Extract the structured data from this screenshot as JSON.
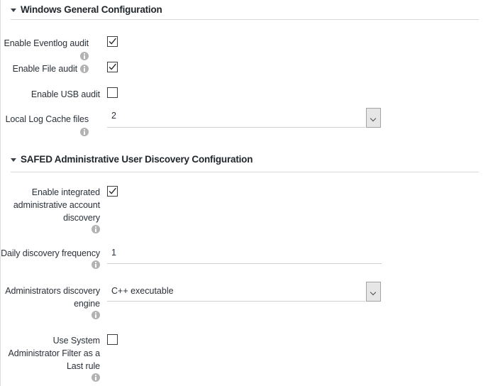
{
  "sections": [
    {
      "id": "windows-general",
      "title": "Windows General Configuration",
      "caret": "caret-down-icon",
      "fields": [
        {
          "id": "enable-eventlog-audit",
          "label": "Enable Eventlog audit",
          "info_icon": "info-icon",
          "control": "checkbox",
          "checked": true,
          "checked_label": "Checked"
        },
        {
          "id": "enable-file-audit",
          "label": "Enable File audit",
          "info_icon": "info-icon",
          "control": "checkbox",
          "checked": true,
          "checked_label": "Checked"
        },
        {
          "id": "enable-usb-audit",
          "label": "Enable USB audit",
          "info_icon": null,
          "control": "checkbox",
          "checked": false,
          "checked_label": "Unchecked"
        },
        {
          "id": "local-log-cache-files",
          "label": "Local Log Cache files",
          "info_icon": "info-icon",
          "control": "select",
          "value": "2",
          "chevron_icon": "chevron-down-icon"
        }
      ]
    },
    {
      "id": "safed-admin-discovery",
      "title": "SAFED Administrative User Discovery Configuration",
      "caret": "caret-down-icon",
      "fields": [
        {
          "id": "enable-integrated-admin-account-discovery",
          "label_lines": [
            "Enable integrated",
            "administrative account",
            "discovery"
          ],
          "info_icon": "info-icon",
          "control": "checkbox",
          "checked": true,
          "checked_label": "Checked"
        },
        {
          "id": "daily-discovery-frequency",
          "label_lines": [
            "Daily discovery frequency"
          ],
          "info_icon": "info-icon",
          "control": "text",
          "value": "1"
        },
        {
          "id": "administrators-discovery-engine",
          "label_lines": [
            "Administrators discovery",
            "engine"
          ],
          "info_icon": "info-icon",
          "control": "select",
          "value": "C++ executable",
          "chevron_icon": "chevron-down-icon"
        },
        {
          "id": "use-system-administrator-filter-as-last-rule",
          "label_lines": [
            "Use System",
            "Administrator Filter as a",
            "Last rule"
          ],
          "info_icon": "info-icon",
          "control": "checkbox",
          "checked": false,
          "checked_label": "Unchecked"
        }
      ]
    }
  ]
}
